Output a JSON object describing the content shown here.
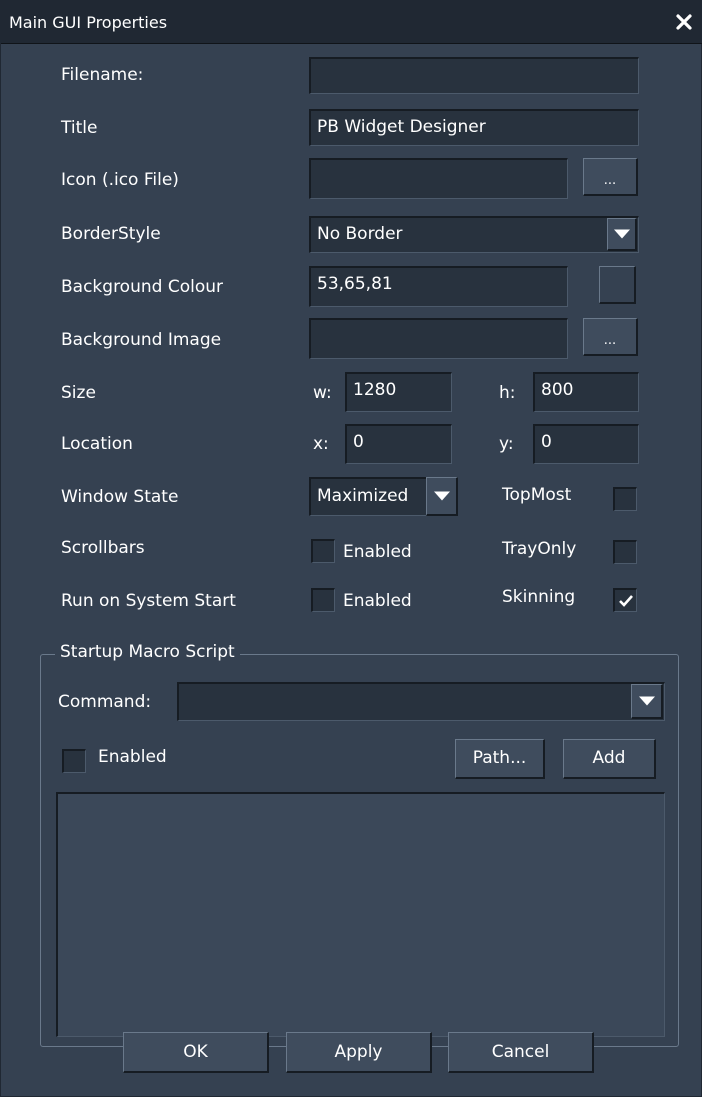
{
  "window": {
    "title": "Main GUI Properties",
    "close_icon": "close-icon"
  },
  "rows": {
    "filename": {
      "label": "Filename:",
      "value": ""
    },
    "title": {
      "label": "Title",
      "value": "PB Widget Designer"
    },
    "icon": {
      "label": "Icon (.ico File)",
      "value": "",
      "browse_label": "..."
    },
    "border_style": {
      "label": "BorderStyle",
      "value": "No Border"
    },
    "background_colour": {
      "label": "Background Colour",
      "value": "53,65,81",
      "swatch_color": "#354151"
    },
    "background_image": {
      "label": "Background Image",
      "value": "",
      "browse_label": "..."
    },
    "size": {
      "label": "Size",
      "w_label": "w:",
      "w_value": "1280",
      "h_label": "h:",
      "h_value": "800"
    },
    "location": {
      "label": "Location",
      "x_label": "x:",
      "x_value": "0",
      "y_label": "y:",
      "y_value": "0"
    },
    "window_state": {
      "label": "Window State",
      "value": "Maximized",
      "topmost_label": "TopMost",
      "topmost_checked": false
    },
    "scrollbars": {
      "label": "Scrollbars",
      "enabled_label": "Enabled",
      "enabled_checked": false,
      "trayonly_label": "TrayOnly",
      "trayonly_checked": false
    },
    "run_on_start": {
      "label": "Run on System Start",
      "enabled_label": "Enabled",
      "enabled_checked": false,
      "skinning_label": "Skinning",
      "skinning_checked": true
    }
  },
  "macro": {
    "legend": "Startup Macro Script",
    "command_label": "Command:",
    "command_value": "",
    "enabled_label": "Enabled",
    "enabled_checked": false,
    "path_button": "Path...",
    "add_button": "Add",
    "script_text": ""
  },
  "footer": {
    "ok": "OK",
    "apply": "Apply",
    "cancel": "Cancel"
  },
  "colors": {
    "background": "#354151",
    "titlebar": "#202833",
    "field": "#28323e",
    "button": "#3f4c5d",
    "text": "#ffffff"
  }
}
